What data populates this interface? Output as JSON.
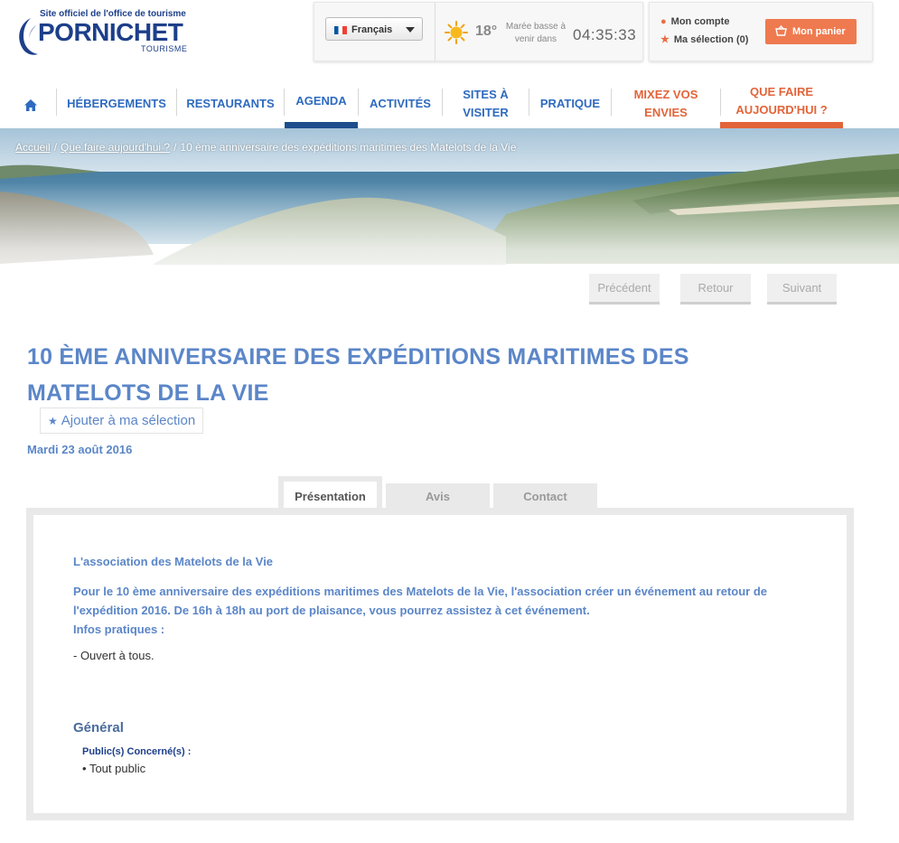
{
  "logo": {
    "tagline": "Site officiel de l'office de tourisme",
    "name": "PORNICHET",
    "subtitle": "TOURISME"
  },
  "header": {
    "language": "Français",
    "temperature": "18°",
    "tide_label": "Marée basse à venir dans",
    "tide_time": "04:35:33",
    "account_label": "Mon compte",
    "selection_label": "Ma sélection (0)",
    "basket_label": "Mon panier"
  },
  "nav": {
    "items": [
      {
        "label": "HÉBERGEMENTS"
      },
      {
        "label": "RESTAURANTS"
      },
      {
        "label": "AGENDA"
      },
      {
        "label": "ACTIVITÉS"
      },
      {
        "label": "SITES À VISITER"
      },
      {
        "label": "PRATIQUE"
      },
      {
        "label": "MIXEZ VOS ENVIES"
      },
      {
        "label": "QUE FAIRE AUJOURD'HUI ?"
      }
    ]
  },
  "breadcrumb": {
    "home": "Accueil",
    "section": "Que faire aujourd'hui ?",
    "current": "10 ème anniversaire des expéditions maritimes des Matelots de la Vie"
  },
  "pager": {
    "previous": "Précédent",
    "back": "Retour",
    "next": "Suivant"
  },
  "event": {
    "title": "10 ÈME ANNIVERSAIRE DES EXPÉDITIONS MARITIMES DES MATELOTS DE LA VIE",
    "add_selection": "Ajouter à ma sélection",
    "date": "Mardi 23 août 2016"
  },
  "tabs": [
    {
      "label": "Présentation",
      "active": true
    },
    {
      "label": "Avis",
      "active": false
    },
    {
      "label": "Contact",
      "active": false
    }
  ],
  "presentation": {
    "heading": "L'association des Matelots de la Vie",
    "body": "Pour le 10 ème anniversaire des expéditions maritimes des Matelots de la Vie, l'association créer un événement au retour de l'expédition 2016. De 16h à 18h au port de plaisance, vous pourrez assistez à cet événement.",
    "infos_label": "Infos pratiques :",
    "list_item": "- Ouvert à tous.",
    "general_title": "Général",
    "public_label": "Public(s) Concerné(s) :",
    "public_value": "Tout public"
  },
  "colors": {
    "brand_blue": "#1d3f8a",
    "link_blue": "#5b86c8",
    "accent_orange": "#e3643a",
    "basket_orange": "#ef7a4f"
  }
}
